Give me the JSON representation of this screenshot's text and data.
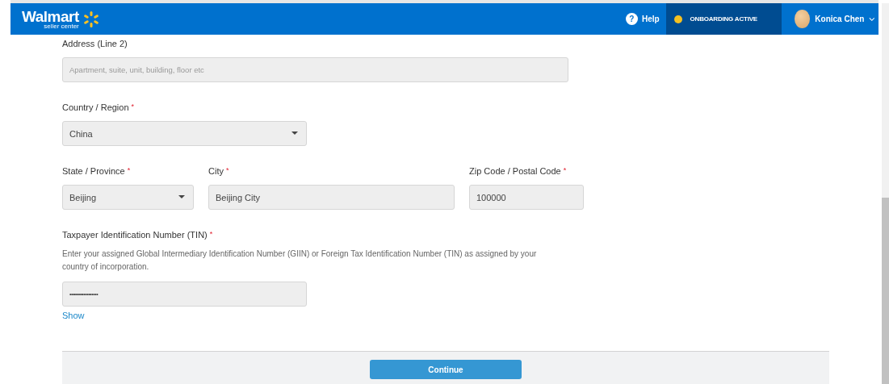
{
  "header": {
    "logo": "Walmart",
    "logo_sub": "seller center",
    "help": "Help",
    "help_icon": "?",
    "status": {
      "label": "ONBOARDING ACTIVE",
      "color": "#f5c121"
    },
    "user": "Konica Chen"
  },
  "form": {
    "rows": [
      {
        "fields": [
          {
            "kind": "text",
            "label": "Address (Line 2)",
            "placeholder": "Apartment, suite, unit, building, floor etc"
          }
        ]
      },
      {
        "fields": [
          {
            "kind": "select",
            "label": "Country / Region",
            "marker": "*",
            "value": "China"
          }
        ]
      },
      {
        "fields": [
          {
            "kind": "select",
            "label": "State / Province",
            "marker": "*",
            "value": "Beijing"
          },
          {
            "kind": "text",
            "label": "City",
            "marker": "*",
            "value": "Beijing City"
          },
          {
            "kind": "text",
            "label": "Zip Code / Postal Code",
            "marker": "*",
            "value": "100000"
          }
        ]
      },
      {
        "fields": [
          {
            "kind": "password",
            "label": "Taxpayer Identification Number (TIN)",
            "marker": "*",
            "description": "Enter your assigned Global Intermediary Identification Number (GIIN) or Foreign Tax Identification Number (TIN) as assigned by your country of incorporation.",
            "value": "••••••••••••••••••",
            "link": "Show"
          }
        ]
      }
    ]
  },
  "footer": {
    "button": "Continue"
  }
}
